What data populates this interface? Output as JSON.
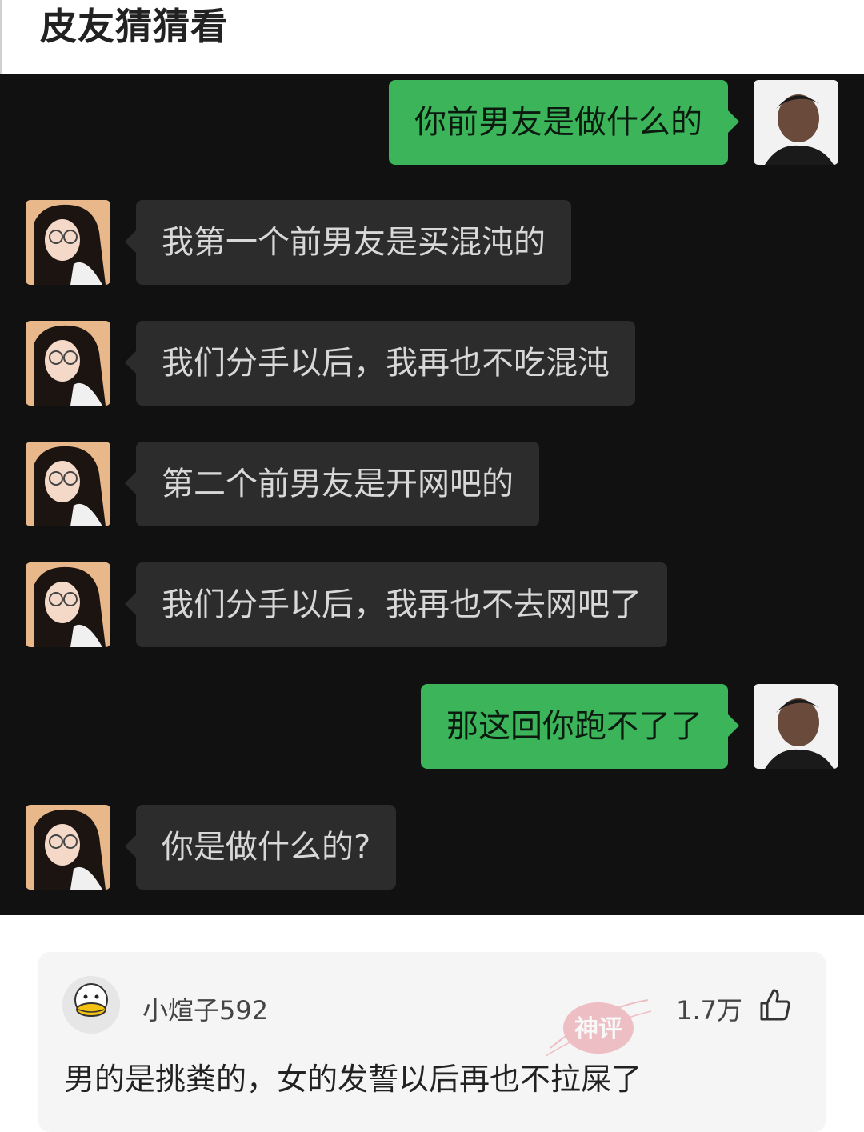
{
  "post": {
    "title": "皮友猜猜看"
  },
  "chat": {
    "messages": [
      {
        "side": "me",
        "text": "你前男友是做什么的"
      },
      {
        "side": "them",
        "text": "我第一个前男友是买混沌的"
      },
      {
        "side": "them",
        "text": "我们分手以后，我再也不吃混沌"
      },
      {
        "side": "them",
        "text": "第二个前男友是开网吧的"
      },
      {
        "side": "them",
        "text": "我们分手以后，我再也不去网吧了"
      },
      {
        "side": "me",
        "text": "那这回你跑不了了"
      },
      {
        "side": "them",
        "text": "你是做什么的?"
      }
    ]
  },
  "comment": {
    "username": "小煊子592",
    "likes": "1.7万",
    "text": "男的是挑粪的，女的发誓以后再也不拉屎了",
    "stamp_text": "神评",
    "avatar_icon": "duck-face-icon",
    "like_icon": "thumbs-up-icon"
  },
  "colors": {
    "chat_bg": "#111111",
    "my_bubble": "#3bb45a",
    "their_bubble": "#2c2c2c",
    "stamp": "#e05a6a"
  }
}
